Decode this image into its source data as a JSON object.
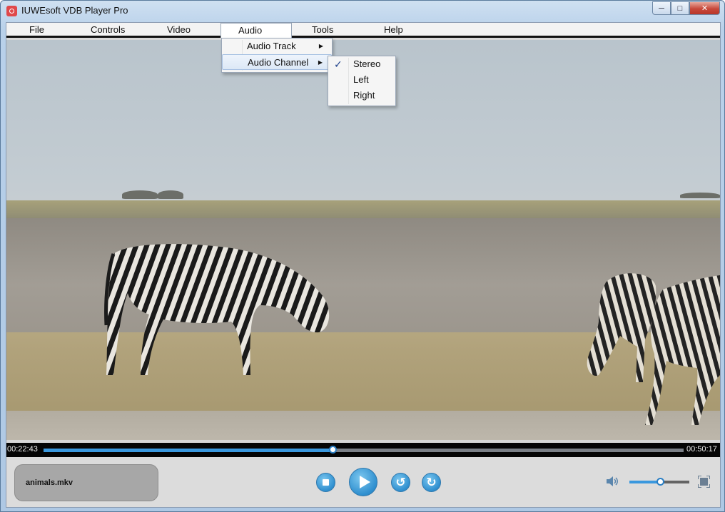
{
  "window": {
    "title": "IUWEsoft VDB Player Pro"
  },
  "menubar": {
    "items": [
      {
        "label": "File"
      },
      {
        "label": "Controls"
      },
      {
        "label": "Video"
      },
      {
        "label": "Audio"
      },
      {
        "label": "Tools"
      },
      {
        "label": "Help"
      }
    ],
    "open_menu": "Audio"
  },
  "audio_menu": {
    "items": [
      {
        "label": "Audio Track",
        "has_submenu": true
      },
      {
        "label": "Audio Channel",
        "has_submenu": true,
        "highlighted": true
      }
    ]
  },
  "audio_channel_submenu": {
    "items": [
      {
        "label": "Stereo",
        "checked": true
      },
      {
        "label": "Left",
        "checked": false
      },
      {
        "label": "Right",
        "checked": false
      }
    ]
  },
  "playback": {
    "current_time": "00:22:43",
    "total_time": "00:50:17",
    "progress_fraction": 0.452,
    "file_name": "animals.mkv",
    "volume_fraction": 0.51
  },
  "icons": {
    "stop": "stop-icon",
    "play": "play-icon",
    "rewind": "rotate-back-icon",
    "forward": "rotate-forward-icon",
    "volume": "speaker-icon",
    "fullscreen": "fullscreen-icon"
  },
  "colors": {
    "accent": "#3a98de",
    "seekbar_bg": "#050505",
    "controls_bg": "#dcdcdc"
  }
}
